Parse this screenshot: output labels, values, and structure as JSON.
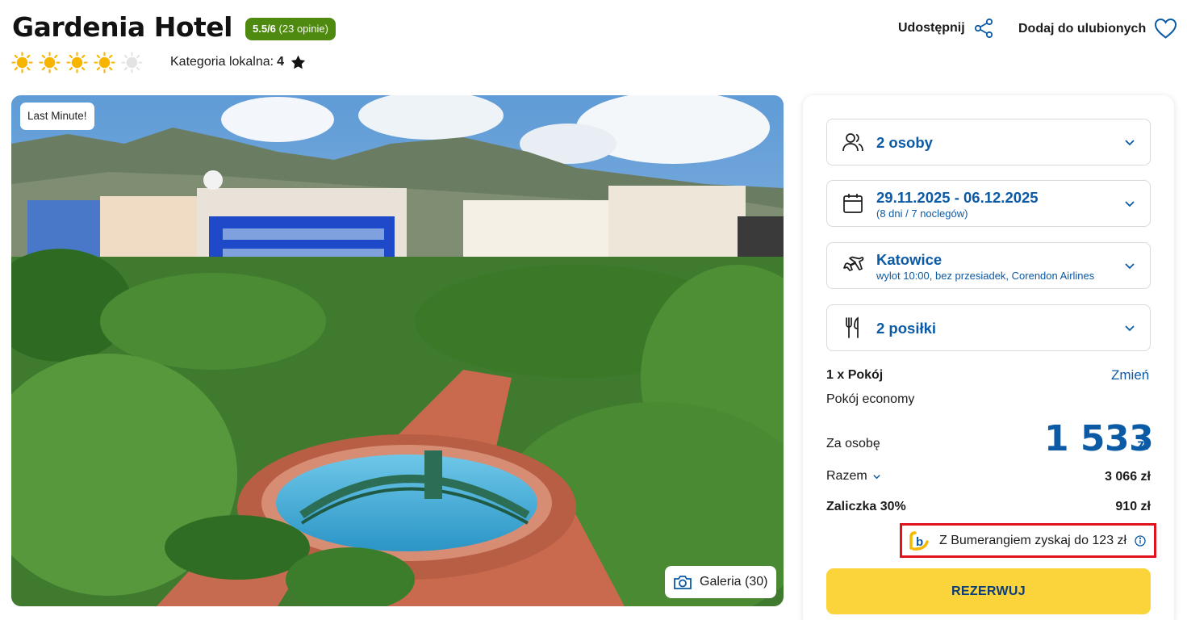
{
  "header": {
    "hotel_name": "Gardenia Hotel",
    "rating_score": "5.5/6",
    "rating_count": "(23 opinie)",
    "sun_rating": 4,
    "sun_max": 5,
    "local_category_label": "Kategoria lokalna:",
    "local_category_value": "4",
    "share_label": "Udostępnij",
    "favorite_label": "Dodaj do ulubionych"
  },
  "photo": {
    "badge": "Last Minute!",
    "gallery_label": "Galeria (30)"
  },
  "booking": {
    "guests": {
      "icon": "people-icon",
      "label": "2 osoby"
    },
    "dates": {
      "icon": "calendar-icon",
      "label": "29.11.2025 - 06.12.2025",
      "sub": "(8 dni / 7 noclegów)"
    },
    "flight": {
      "icon": "plane-icon",
      "label": "Katowice",
      "sub": "wylot 10:00, bez przesiadek, Corendon Airlines"
    },
    "meals": {
      "icon": "fork-knife-icon",
      "label": "2 posiłki"
    },
    "room_count": "1 x Pokój",
    "change_label": "Zmień",
    "room_type": "Pokój economy",
    "per_person_label": "Za osobę",
    "per_person_price": "1 533",
    "currency": "zł",
    "total_label": "Razem",
    "total_value": "3 066 zł",
    "deposit_label": "Zaliczka 30%",
    "deposit_value": "910 zł",
    "bumerang_text": "Z Bumerangiem zyskaj do 123 zł",
    "reserve_label": "REZERWUJ"
  },
  "colors": {
    "accent_blue": "#0b5aa6",
    "rating_green": "#4f8a10",
    "reserve_yellow": "#fbd33b",
    "highlight_red": "#e0121b"
  }
}
